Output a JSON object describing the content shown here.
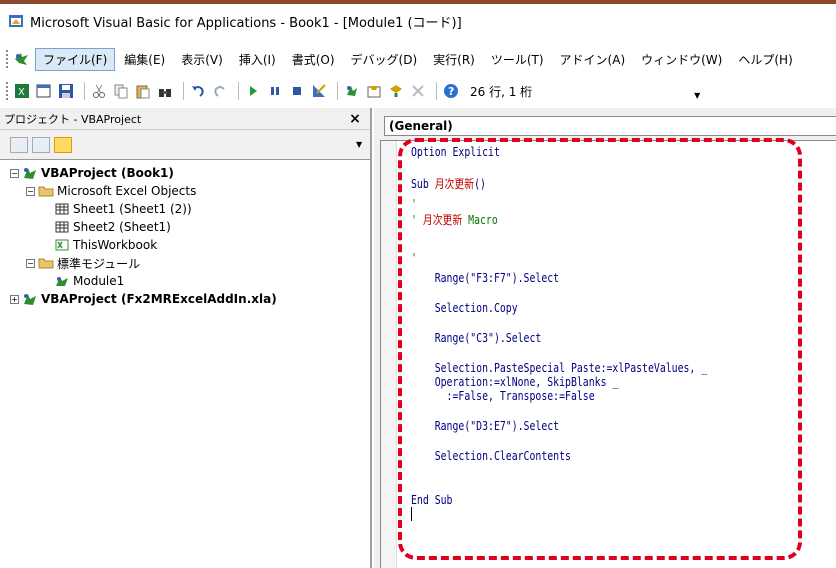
{
  "window": {
    "title": "Microsoft Visual Basic for Applications - Book1 - [Module1 (コード)]"
  },
  "menu": {
    "items": [
      "ファイル(F)",
      "編集(E)",
      "表示(V)",
      "挿入(I)",
      "書式(O)",
      "デバッグ(D)",
      "実行(R)",
      "ツール(T)",
      "アドイン(A)",
      "ウィンドウ(W)",
      "ヘルプ(H)"
    ]
  },
  "toolbar": {
    "position_status": "26 行, 1 桁"
  },
  "project": {
    "title": "プロジェクト - VBAProject",
    "close_label": "×",
    "tree": {
      "root1": "VBAProject (Book1)",
      "folder1": "Microsoft Excel Objects",
      "sheet1": "Sheet1 (Sheet1 (2))",
      "sheet2": "Sheet2 (Sheet1)",
      "workbook": "ThisWorkbook",
      "folder2": "標準モジュール",
      "module1": "Module1",
      "root2": "VBAProject (Fx2MRExcelAddIn.xla)"
    }
  },
  "code": {
    "object_combo": "(General)",
    "lines": {
      "l1": "Option Explicit",
      "l2_kw": "Sub ",
      "l2_name": "月次更新",
      "l2_paren": "()",
      "l3": "'",
      "l4_q": "' ",
      "l4_name": "月次更新",
      "l4_rest": " Macro",
      "l5": "'",
      "l6": "    Range(\"F3:F7\").Select",
      "l7": "    Selection.Copy",
      "l8": "    Range(\"C3\").Select",
      "l9": "    Selection.PasteSpecial Paste:=xlPasteValues, _",
      "l10": "    Operation:=xlNone, SkipBlanks _",
      "l11": "      :=False, Transpose:=False",
      "l12": "    Range(\"D3:E7\").Select",
      "l13": "    Selection.ClearContents",
      "l14": "End Sub"
    }
  },
  "colors": {
    "highlight_frame": "#e0001b",
    "keyword": "#000080",
    "japanese_text": "#c00000",
    "comment": "#007700"
  }
}
